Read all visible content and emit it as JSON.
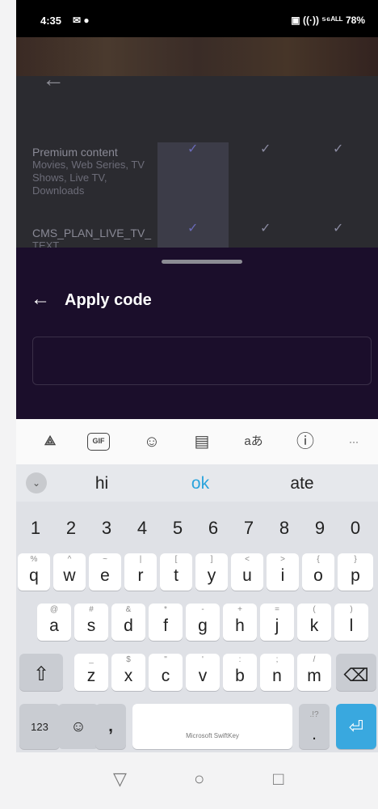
{
  "status_bar": {
    "time": "4:35",
    "left_icons": "✉ ●",
    "right_icons": "▣ ((·)) ⁵⁶ᴬᴸᴸ",
    "battery": "78%"
  },
  "background": {
    "features": [
      {
        "title": "Premium content",
        "subtitle": "Movies, Web Series, TV Shows, Live TV, Downloads"
      },
      {
        "title": "CMS_PLAN_LIVE_TV_",
        "subtitle": "TEXT"
      }
    ],
    "check_glyph": "✓"
  },
  "sheet": {
    "back_glyph": "←",
    "title": "Apply code",
    "code_input_value": "",
    "code_input_placeholder": ""
  },
  "keyboard": {
    "toolbar": {
      "copilot": "⟁",
      "gif": "GIF",
      "sticker": "☺",
      "clipboard": "▤",
      "translate": "aあ",
      "info": "ⓘ",
      "more": "···"
    },
    "collapse_glyph": "⌄",
    "suggestions": [
      "hi",
      "ok",
      "ate"
    ],
    "number_row": [
      "1",
      "2",
      "3",
      "4",
      "5",
      "6",
      "7",
      "8",
      "9",
      "0"
    ],
    "row1": [
      {
        "main": "q",
        "alt": "%"
      },
      {
        "main": "w",
        "alt": "^"
      },
      {
        "main": "e",
        "alt": "~"
      },
      {
        "main": "r",
        "alt": "|"
      },
      {
        "main": "t",
        "alt": "["
      },
      {
        "main": "y",
        "alt": "]"
      },
      {
        "main": "u",
        "alt": "<"
      },
      {
        "main": "i",
        "alt": ">"
      },
      {
        "main": "o",
        "alt": "{"
      },
      {
        "main": "p",
        "alt": "}"
      }
    ],
    "row2": [
      {
        "main": "a",
        "alt": "@"
      },
      {
        "main": "s",
        "alt": "#"
      },
      {
        "main": "d",
        "alt": "&"
      },
      {
        "main": "f",
        "alt": "*"
      },
      {
        "main": "g",
        "alt": "-"
      },
      {
        "main": "h",
        "alt": "+"
      },
      {
        "main": "j",
        "alt": "="
      },
      {
        "main": "k",
        "alt": "("
      },
      {
        "main": "l",
        "alt": ")"
      }
    ],
    "row3": [
      {
        "main": "z",
        "alt": "_"
      },
      {
        "main": "x",
        "alt": "$"
      },
      {
        "main": "c",
        "alt": "\""
      },
      {
        "main": "v",
        "alt": "'"
      },
      {
        "main": "b",
        "alt": ":"
      },
      {
        "main": "n",
        "alt": ";"
      },
      {
        "main": "m",
        "alt": "/"
      }
    ],
    "shift_glyph": "⇧",
    "backspace_glyph": "⌫",
    "symbols_label": "123",
    "emoji_glyph": "☺",
    "comma_label": ",",
    "space_label": "Microsoft SwiftKey",
    "period_label": ".",
    "period_alt": ".!?",
    "enter_glyph": "⏎"
  },
  "nav_bar": {
    "back": "▽",
    "home": "○",
    "recents": "□"
  }
}
